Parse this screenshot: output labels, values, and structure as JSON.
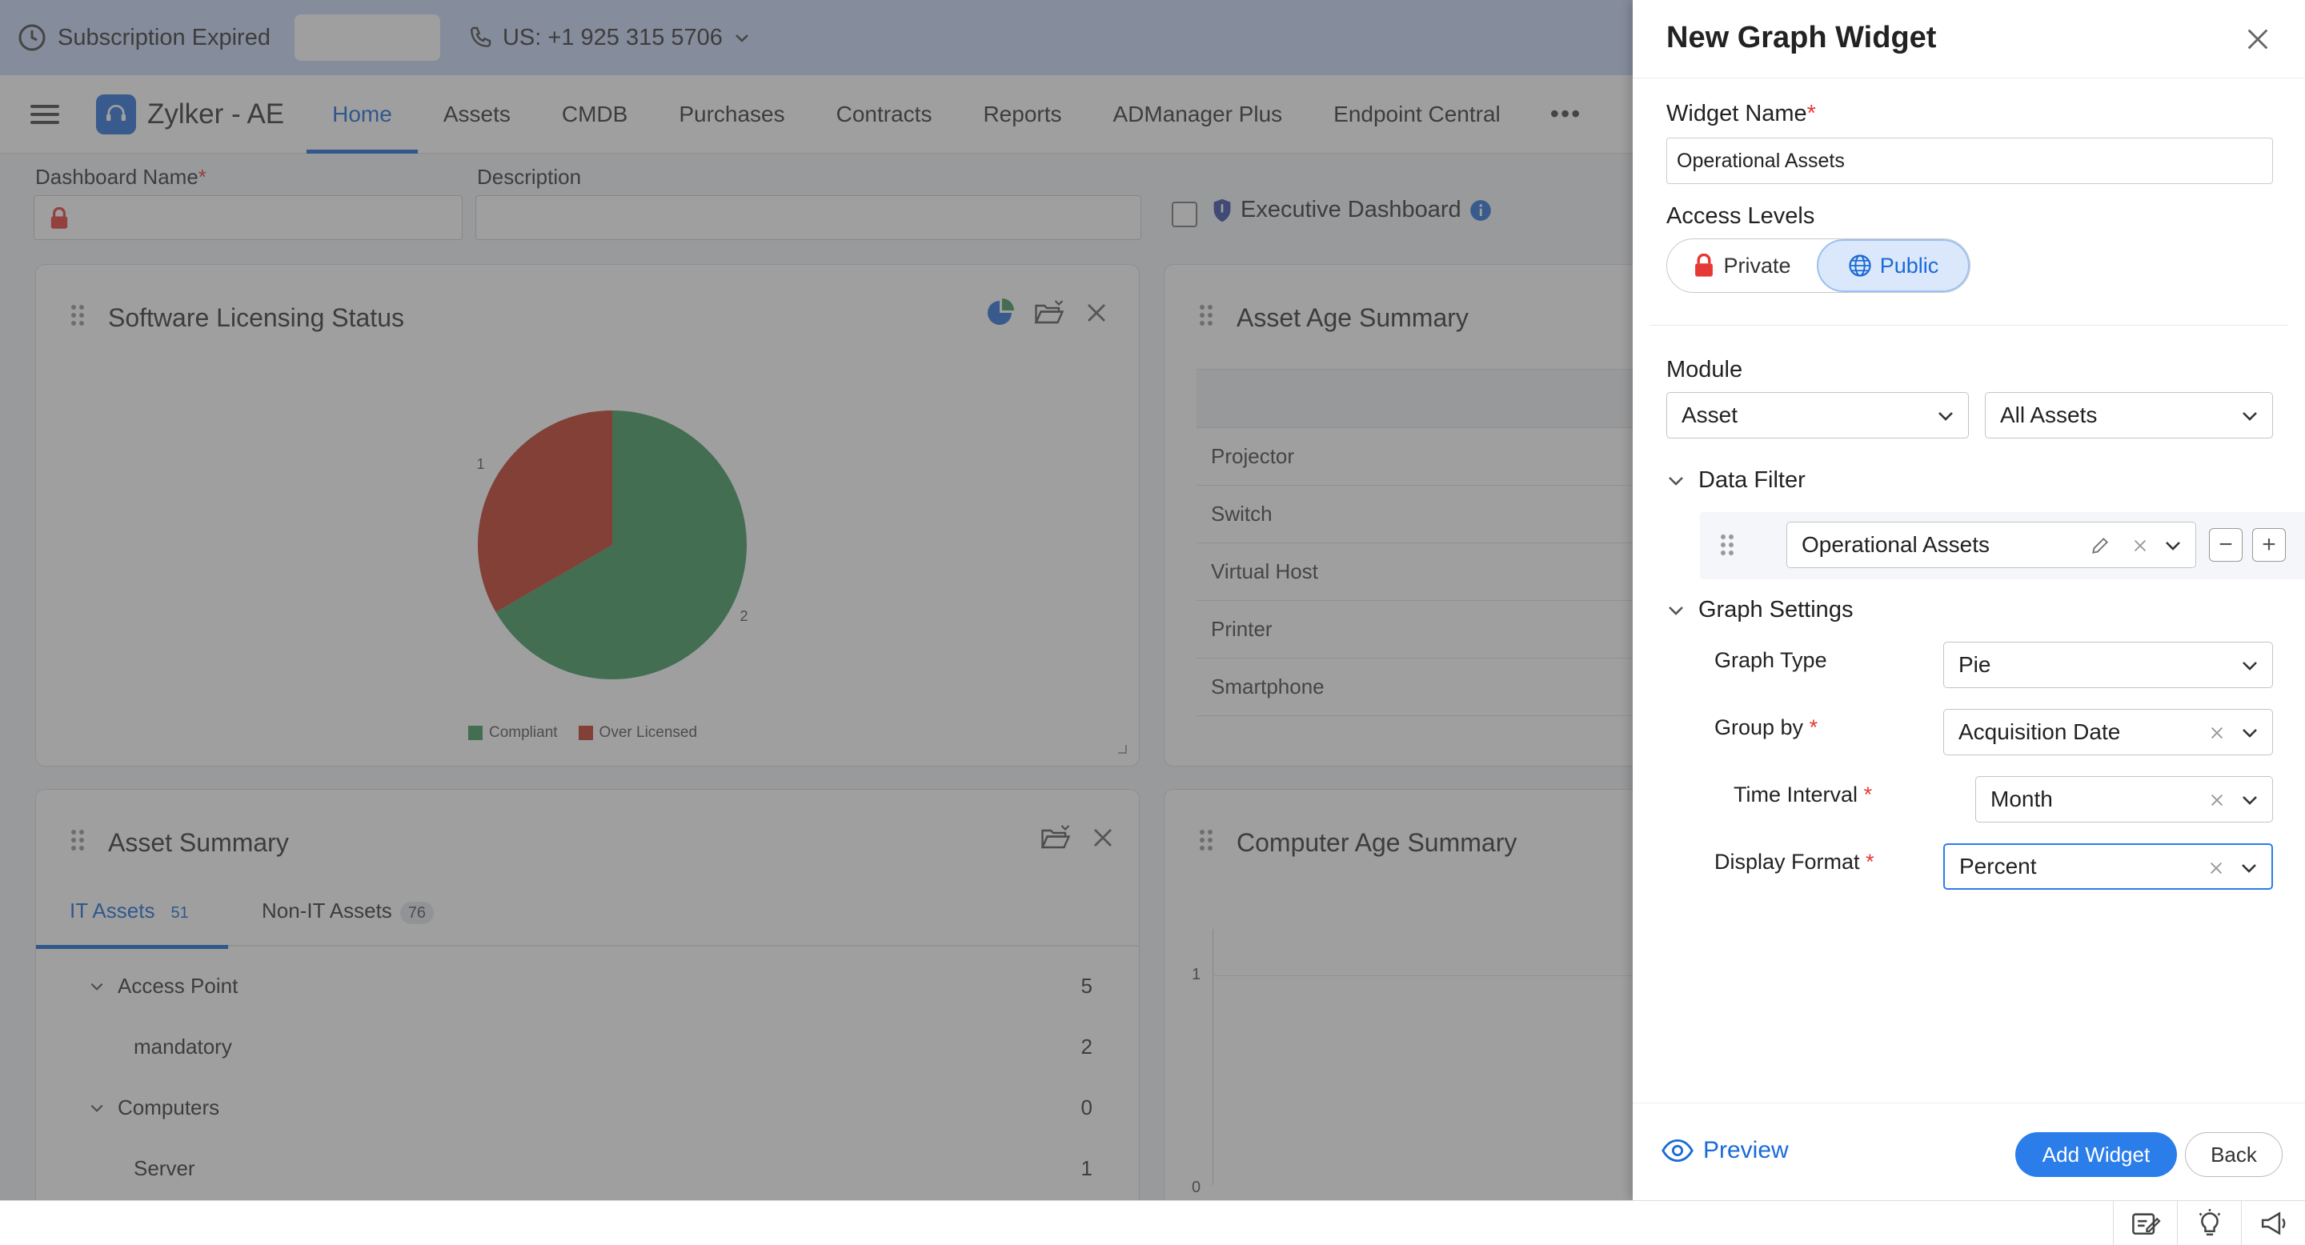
{
  "subscription": {
    "status_text": "Subscription Expired",
    "phone": "US: +1 925 315 5706"
  },
  "nav": {
    "brand": "Zylker - AE",
    "tabs": [
      "Home",
      "Assets",
      "CMDB",
      "Purchases",
      "Contracts",
      "Reports",
      "ADManager Plus",
      "Endpoint Central"
    ],
    "more": "•••"
  },
  "dashboard_form": {
    "name_label": "Dashboard Name",
    "req_mark": "*",
    "description_label": "Description",
    "executive_label": "Executive Dashboard"
  },
  "widgets": {
    "software_licensing": {
      "title": "Software Licensing Status",
      "legend": [
        "Compliant",
        "Over Licensed"
      ],
      "slice_labels": [
        "1",
        "2"
      ]
    },
    "asset_age": {
      "title": "Asset Age Summary",
      "rows": [
        "Projector",
        "Switch",
        "Virtual Host",
        "Printer",
        "Smartphone"
      ]
    },
    "asset_summary": {
      "title": "Asset Summary",
      "tabs": [
        {
          "label": "IT Assets",
          "count": "51"
        },
        {
          "label": "Non-IT Assets",
          "count": "76"
        }
      ],
      "rows": [
        {
          "name": "Access Point",
          "value": "5"
        },
        {
          "name": "mandatory",
          "value": "2"
        },
        {
          "name": "Computers",
          "value": "0"
        },
        {
          "name": "Server",
          "value": "1"
        }
      ]
    },
    "computer_age": {
      "title": "Computer Age Summary",
      "y_ticks": [
        "1",
        "0"
      ]
    }
  },
  "chart_data": {
    "type": "pie",
    "title": "Software Licensing Status",
    "series": [
      {
        "name": "Compliant",
        "value": 2,
        "color": "#3f9a5c"
      },
      {
        "name": "Over Licensed",
        "value": 1,
        "color": "#c23a27"
      }
    ],
    "legend": "bottom"
  },
  "panel": {
    "title": "New Graph Widget",
    "widget_name_label": "Widget Name",
    "widget_name_value": "Operational Assets",
    "access_levels_label": "Access Levels",
    "access_options": [
      "Private",
      "Public"
    ],
    "access_selected": "Public",
    "module_label": "Module",
    "module_value": "Asset",
    "module_view_value": "All Assets",
    "data_filter_label": "Data Filter",
    "filter_value": "Operational Assets",
    "filter_minus": "−",
    "filter_plus": "+",
    "graph_settings_label": "Graph Settings",
    "graph_type_label": "Graph Type",
    "graph_type_value": "Pie",
    "group_by_label": "Group by",
    "group_by_value": "Acquisition Date",
    "time_interval_label": "Time Interval",
    "time_interval_value": "Month",
    "display_format_label": "Display Format",
    "display_format_value": "Percent",
    "preview_label": "Preview",
    "add_button": "Add Widget",
    "back_button": "Back"
  },
  "colors": {
    "accent": "#2b7de9",
    "required": "#e53935"
  }
}
